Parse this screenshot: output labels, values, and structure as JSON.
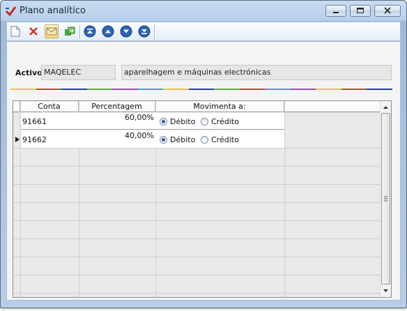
{
  "window": {
    "title": "Plano analítico"
  },
  "toolbar": {
    "buttons": [
      {
        "icon": "new-document-icon"
      },
      {
        "icon": "delete-icon"
      },
      {
        "icon": "envelope-icon"
      },
      {
        "icon": "refresh-icon"
      },
      {
        "icon": "first-record-icon"
      },
      {
        "icon": "previous-record-icon"
      },
      {
        "icon": "next-record-icon"
      },
      {
        "icon": "last-record-icon"
      }
    ]
  },
  "form": {
    "activo_label": "Activo",
    "activo_code": "MAQELEC",
    "activo_description": "aparelhagem e máquinas electrónicas"
  },
  "grid": {
    "columns": [
      "Conta",
      "Percentagem",
      "Movimenta a:"
    ],
    "rows": [
      {
        "conta": "91661",
        "percentagem": "60,00%",
        "movimenta": "Débito",
        "current": false
      },
      {
        "conta": "91662",
        "percentagem": "40,00%",
        "movimenta": "Débito",
        "current": true
      }
    ],
    "radio_options": [
      "Débito",
      "Crédito"
    ]
  },
  "colors": {
    "accent": "#2c5aa8",
    "rainbow": [
      "#e8c34a",
      "#d63b3b",
      "#2b3f9c",
      "#5fae4a",
      "#9b4aa8",
      "#3aa6c8",
      "#e8c34a",
      "#2b3f9c",
      "#5fae4a",
      "#d63b3b",
      "#3aa6c8",
      "#9b4aa8",
      "#e8c34a",
      "#d63b3b",
      "#2b3f9c"
    ]
  }
}
